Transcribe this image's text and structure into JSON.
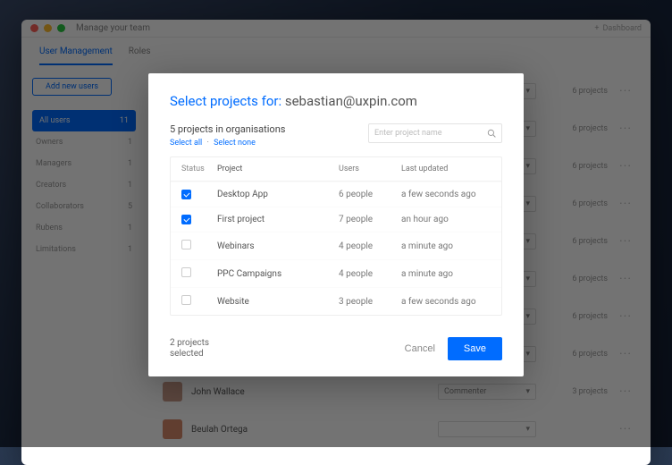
{
  "window": {
    "title": "Manage your team",
    "right_label": "Dashboard"
  },
  "tabs": [
    {
      "label": "User Management",
      "active": true
    },
    {
      "label": "Roles",
      "active": false
    }
  ],
  "sidebar": {
    "add_btn": "Add new users",
    "items": [
      {
        "label": "All users",
        "count": "11",
        "active": true
      },
      {
        "label": "Owners",
        "count": "1"
      },
      {
        "label": "Managers",
        "count": "1"
      },
      {
        "label": "Creators",
        "count": "1"
      },
      {
        "label": "Collaborators",
        "count": "5"
      },
      {
        "label": "Rubens",
        "count": "1"
      },
      {
        "label": "Limitations",
        "count": "1"
      }
    ]
  },
  "users": [
    {
      "name": "",
      "role": "",
      "projects": "6 projects"
    },
    {
      "name": "",
      "role": "",
      "projects": "6 projects"
    },
    {
      "name": "",
      "role": "",
      "projects": "6 projects"
    },
    {
      "name": "",
      "role": "",
      "projects": "6 projects"
    },
    {
      "name": "",
      "role": "",
      "projects": "6 projects"
    },
    {
      "name": "",
      "role": "",
      "projects": "6 projects"
    },
    {
      "name": "",
      "role": "",
      "projects": "6 projects"
    },
    {
      "name": "",
      "role": "",
      "projects": "6 projects"
    },
    {
      "name": "John Wallace",
      "role": "Commenter",
      "projects": "3 projects"
    },
    {
      "name": "Beulah Ortega",
      "role": "",
      "projects": ""
    }
  ],
  "modal": {
    "title_prefix": "Select projects for:",
    "title_email": "sebastian@uxpin.com",
    "sub_count": "5 projects in organisations",
    "select_all": "Select all",
    "select_none": "Select none",
    "search_placeholder": "Enter project name",
    "columns": {
      "status": "Status",
      "project": "Project",
      "users": "Users",
      "updated": "Last updated"
    },
    "rows": [
      {
        "checked": true,
        "project": "Desktop App",
        "users": "6 people",
        "updated": "a few seconds ago"
      },
      {
        "checked": true,
        "project": "First project",
        "users": "7 people",
        "updated": "an hour ago"
      },
      {
        "checked": false,
        "project": "Webinars",
        "users": "4 people",
        "updated": "a minute ago"
      },
      {
        "checked": false,
        "project": "PPC Campaigns",
        "users": "4 people",
        "updated": "a minute ago"
      },
      {
        "checked": false,
        "project": "Website",
        "users": "3 people",
        "updated": "a few seconds ago"
      }
    ],
    "footer_text": "2 projects selected",
    "cancel": "Cancel",
    "save": "Save"
  }
}
